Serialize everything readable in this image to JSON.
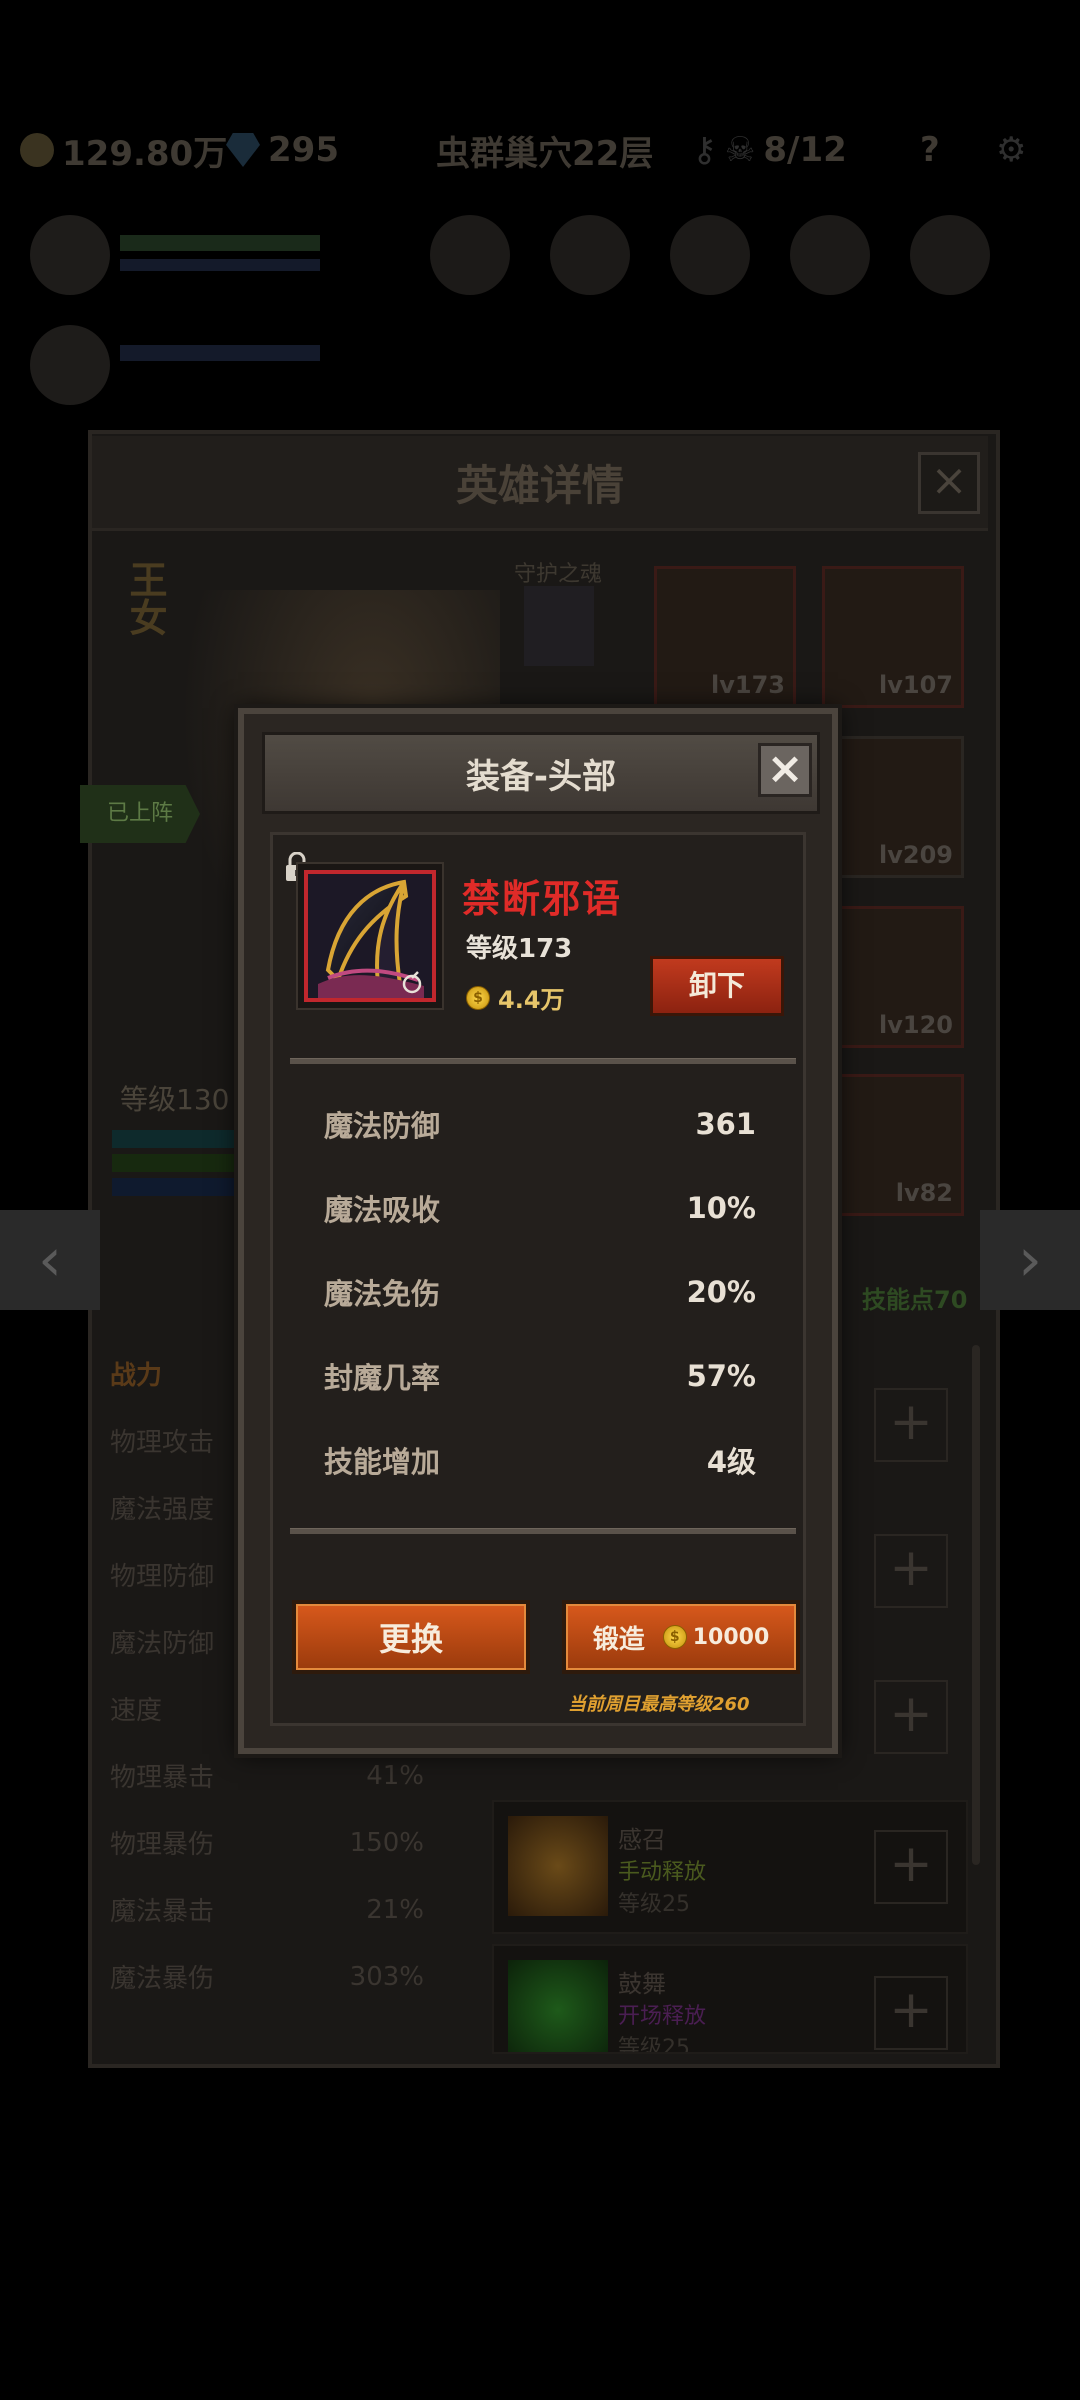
{
  "background": {
    "gold": "129.80万",
    "gems": "295",
    "location": "虫群巢穴22层",
    "keys_label": "8/12",
    "help": "?",
    "panel_title": "英雄详情",
    "close": "×",
    "hero_name": "王女",
    "guard_label": "守护之魂",
    "deployed_label": "已上阵",
    "level_label": "等级130",
    "nav_prev": "‹",
    "nav_next": "›",
    "stats_header": "战力",
    "stats": [
      {
        "label": "物理攻击",
        "value": ""
      },
      {
        "label": "魔法强度",
        "value": ""
      },
      {
        "label": "物理防御",
        "value": ""
      },
      {
        "label": "魔法防御",
        "value": ""
      },
      {
        "label": "速度",
        "value": ""
      },
      {
        "label": "物理暴击",
        "value": "41%"
      },
      {
        "label": "物理暴伤",
        "value": "150%"
      },
      {
        "label": "魔法暴击",
        "value": "21%"
      },
      {
        "label": "魔法暴伤",
        "value": "303%"
      }
    ],
    "equipment": [
      {
        "level": "lv173"
      },
      {
        "level": "lv107"
      },
      {
        "level": "lv209"
      },
      {
        "level": "lv120"
      },
      {
        "level": "lv82"
      }
    ],
    "skill_points": "技能点70",
    "skills": [
      {
        "name": "感召",
        "mode": "手动释放",
        "level": "等级25",
        "mode_color": "#4a5a1e"
      },
      {
        "name": "鼓舞",
        "mode": "开场释放",
        "level": "等级25",
        "mode_color": "#4a1e52"
      }
    ],
    "plus": "+"
  },
  "modal": {
    "title": "装备-头部",
    "close": "×",
    "item": {
      "name": "禁断邪语",
      "level": "等级173",
      "price": "4.4万"
    },
    "unequip_label": "卸下",
    "stats": [
      {
        "label": "魔法防御",
        "value": "361"
      },
      {
        "label": "魔法吸收",
        "value": "10%"
      },
      {
        "label": "魔法免伤",
        "value": "20%"
      },
      {
        "label": "封魔几率",
        "value": "57%"
      },
      {
        "label": "技能增加",
        "value": "4级"
      }
    ],
    "swap_label": "更换",
    "forge_label": "锻造",
    "forge_cost": "10000",
    "max_level_note": "当前周目最高等级260"
  },
  "colors": {
    "item_name": "#e02b28",
    "button_orange": "#d8591c",
    "note_gold": "#e0a030"
  }
}
